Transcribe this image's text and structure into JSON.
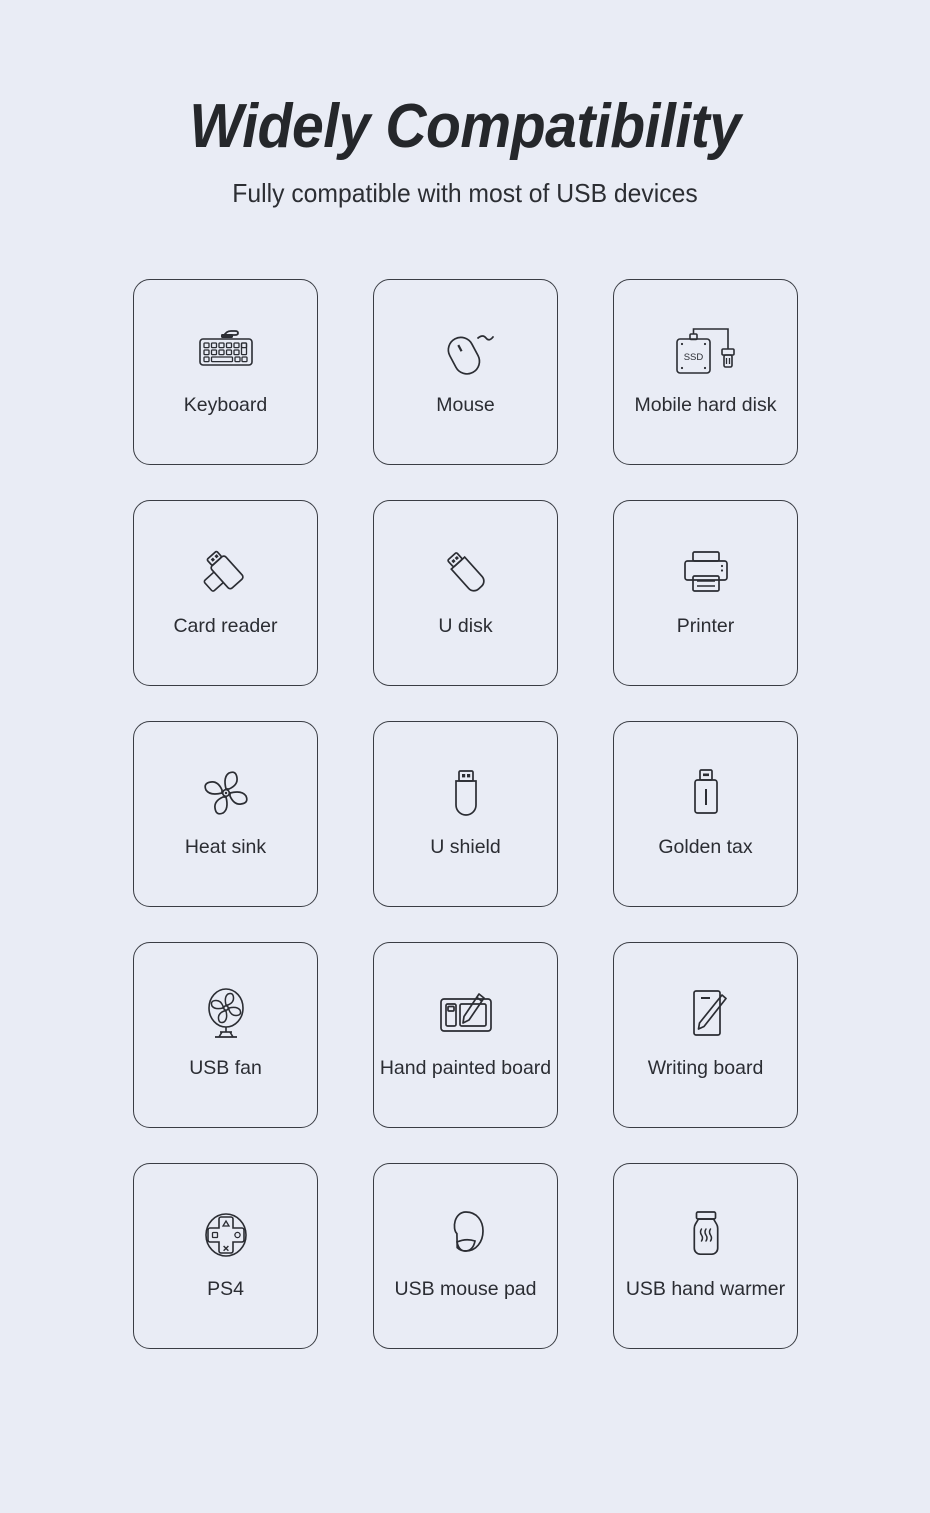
{
  "header": {
    "title": "Widely Compatibility",
    "subtitle": "Fully compatible with most of USB devices"
  },
  "colors": {
    "background": "#e9ecf5",
    "card_border": "#3a3d44",
    "icon_stroke": "#2b2d33",
    "title_text": "#25272b",
    "label_text": "#2b2d33"
  },
  "grid": {
    "columns": 3,
    "rows": 5,
    "cards": [
      {
        "label": "Keyboard",
        "icon": "keyboard-icon"
      },
      {
        "label": "Mouse",
        "icon": "mouse-icon"
      },
      {
        "label": "Mobile hard disk",
        "icon": "ssd-drive-icon",
        "icon_text": "SSD"
      },
      {
        "label": "Card reader",
        "icon": "card-reader-icon"
      },
      {
        "label": "U disk",
        "icon": "usb-flash-drive-icon"
      },
      {
        "label": "Printer",
        "icon": "printer-icon"
      },
      {
        "label": "Heat sink",
        "icon": "fan-blades-icon"
      },
      {
        "label": "U shield",
        "icon": "usb-shield-icon"
      },
      {
        "label": "Golden tax",
        "icon": "usb-key-icon"
      },
      {
        "label": "USB fan",
        "icon": "desk-fan-icon"
      },
      {
        "label": "Hand painted board",
        "icon": "drawing-tablet-icon"
      },
      {
        "label": "Writing board",
        "icon": "writing-board-icon"
      },
      {
        "label": "PS4",
        "icon": "gamepad-dpad-icon"
      },
      {
        "label": "USB mouse pad",
        "icon": "mouse-pad-icon"
      },
      {
        "label": "USB hand warmer",
        "icon": "hand-warmer-icon"
      }
    ]
  }
}
